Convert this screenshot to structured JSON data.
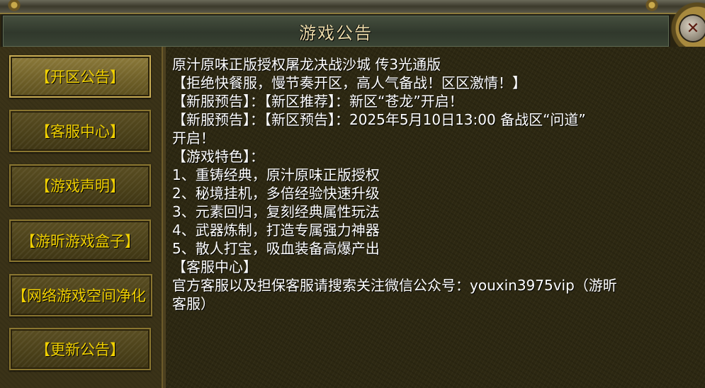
{
  "window": {
    "title": "游戏公告",
    "close_icon": "close-icon"
  },
  "sidebar": {
    "items": [
      {
        "label": "【开区公告】",
        "active": true
      },
      {
        "label": "【客服中心】",
        "active": false
      },
      {
        "label": "【游戏声明】",
        "active": false
      },
      {
        "label": "【游昕游戏盒子】",
        "active": false
      },
      {
        "label": "【网络游戏空间净化",
        "active": false
      },
      {
        "label": "【更新公告】",
        "active": false
      }
    ]
  },
  "content": {
    "lines": [
      "原汁原味正版授权屠龙决战沙城 传3光通版",
      "【拒绝快餐服，慢节奏开区，高人气备战！区区激情！】",
      "【新服预告】：【新区推荐】：新区“苍龙”开启！",
      "【新服预告】：【新区预告】：2025年5月10日13:00 备战区“问道”",
      "开启！",
      "【游戏特色】：",
      "1、重铸经典，原汁原味正版授权",
      "2、秘境挂机，多倍经验快速升级",
      "3、元素回归，复刻经典属性玩法",
      "4、武器炼制，打造专属强力神器",
      "5、散人打宝，吸血装备高爆产出",
      "【客服中心】",
      "官方客服以及担保客服请搜索关注微信公众号：youxin3975vip（游昕",
      "客服）"
    ]
  },
  "colors": {
    "button_text": "#f0d000",
    "title_text": "#e9d9a8",
    "body_text": "#ffffff"
  }
}
